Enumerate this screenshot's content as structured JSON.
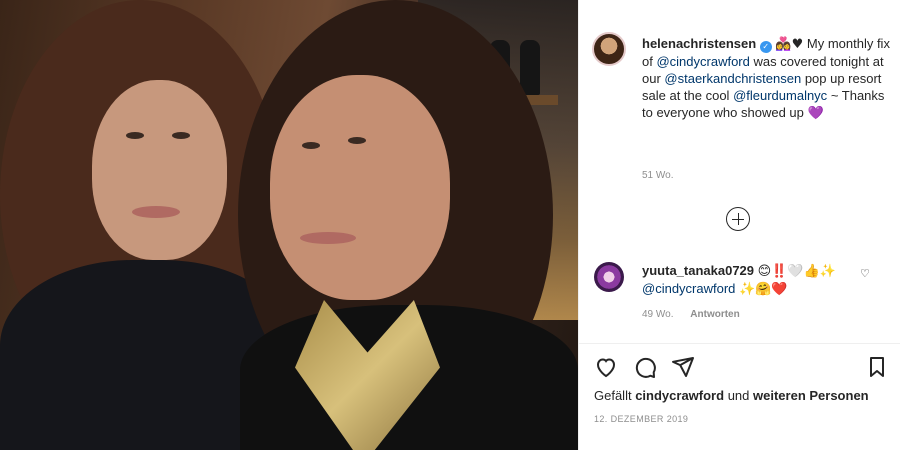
{
  "post": {
    "username": "helenachristensen",
    "caption_before": " My monthly fix of ",
    "mention_1": "@cindycrawford",
    "caption_middle": " was covered tonight at our ",
    "mention_2": "@staerkandchristensen",
    "caption_middle_2": " pop up resort sale at the cool ",
    "mention_3": "@fleurdumalnyc",
    "caption_end": " ~ Thanks to everyone who showed up ",
    "emoji_before": "👩‍❤️‍👩♥",
    "emoji_end": "💜",
    "time": "51 Wo."
  },
  "comment": {
    "username": "yuuta_tanaka0729",
    "emoji_1": "😊‼️🤍👍✨",
    "mention": "@cindycrawford",
    "emoji_2": "✨🤗❤️",
    "time": "49 Wo.",
    "reply_label": "Antworten"
  },
  "likes": {
    "prefix": "Gefällt",
    "name": "cindycrawford",
    "connector": "und",
    "suffix": "weiteren Personen"
  },
  "date": "12. DEZEMBER 2019",
  "icons": {
    "like": "heart-icon",
    "comment": "comment-icon",
    "share": "share-icon",
    "save": "bookmark-icon",
    "load_more": "plus-circle-icon",
    "verified": "verified-badge-icon"
  }
}
